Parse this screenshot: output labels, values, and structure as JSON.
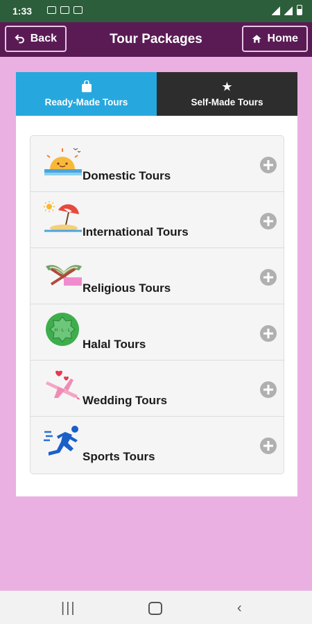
{
  "status_bar": {
    "time": "1:33"
  },
  "app_bar": {
    "back_label": "Back",
    "title": "Tour Packages",
    "home_label": "Home"
  },
  "tabs": [
    {
      "label": "Ready-Made Tours",
      "icon": "shopping-bag-icon",
      "active": true
    },
    {
      "label": "Self-Made Tours",
      "icon": "star-icon",
      "active": false
    }
  ],
  "tour_categories": [
    {
      "label": "Domestic Tours",
      "icon": "sunset-sea-icon"
    },
    {
      "label": "International Tours",
      "icon": "beach-umbrella-icon"
    },
    {
      "label": "Religious Tours",
      "icon": "book-stand-icon"
    },
    {
      "label": "Halal Tours",
      "icon": "halal-badge-icon"
    },
    {
      "label": "Wedding Tours",
      "icon": "airplane-hearts-icon"
    },
    {
      "label": "Sports Tours",
      "icon": "running-man-icon"
    }
  ],
  "colors": {
    "status_bar": "#2d5e3b",
    "app_bar": "#5a1b55",
    "page_background": "#eab0e1",
    "tab_active": "#26a8de",
    "tab_inactive": "#2d2d2d"
  }
}
